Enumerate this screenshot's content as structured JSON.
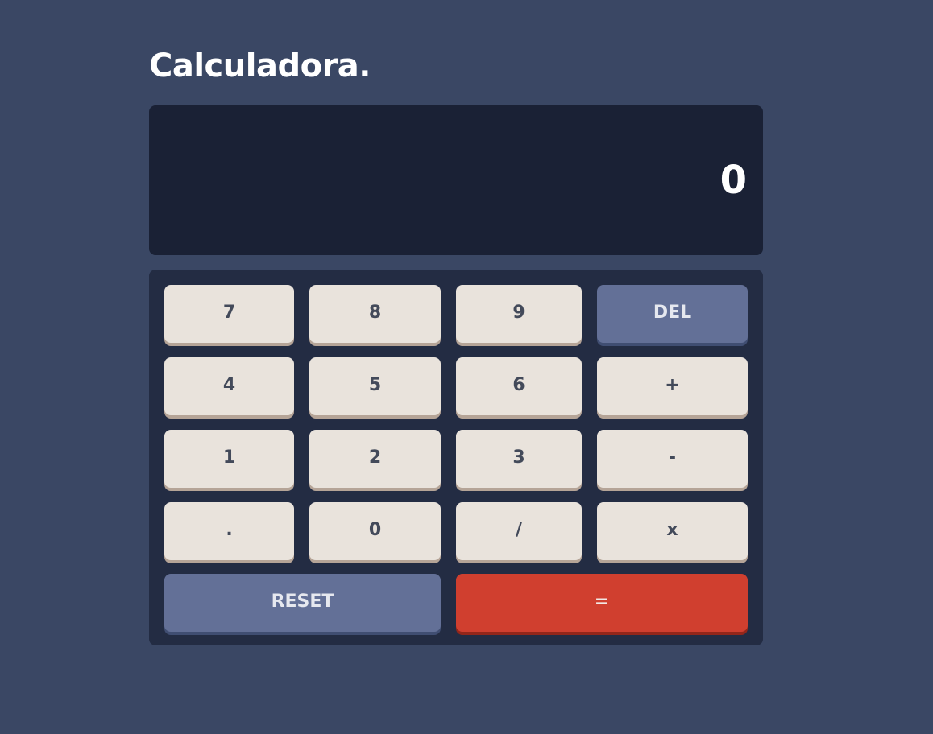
{
  "app": {
    "title": "Calculadora."
  },
  "display": {
    "value": "0"
  },
  "keys": {
    "k7": "7",
    "k8": "8",
    "k9": "9",
    "del": "DEL",
    "k4": "4",
    "k5": "5",
    "k6": "6",
    "plus": "+",
    "k1": "1",
    "k2": "2",
    "k3": "3",
    "minus": "-",
    "dot": ".",
    "k0": "0",
    "divide": "/",
    "multiply": "x",
    "reset": "RESET",
    "equals": "="
  },
  "colors": {
    "background": "#3a4764",
    "display": "#1a2135",
    "keypad": "#232c43",
    "key": "#e9e3dc",
    "function_key": "#637097",
    "equals_key": "#d03f2f"
  }
}
